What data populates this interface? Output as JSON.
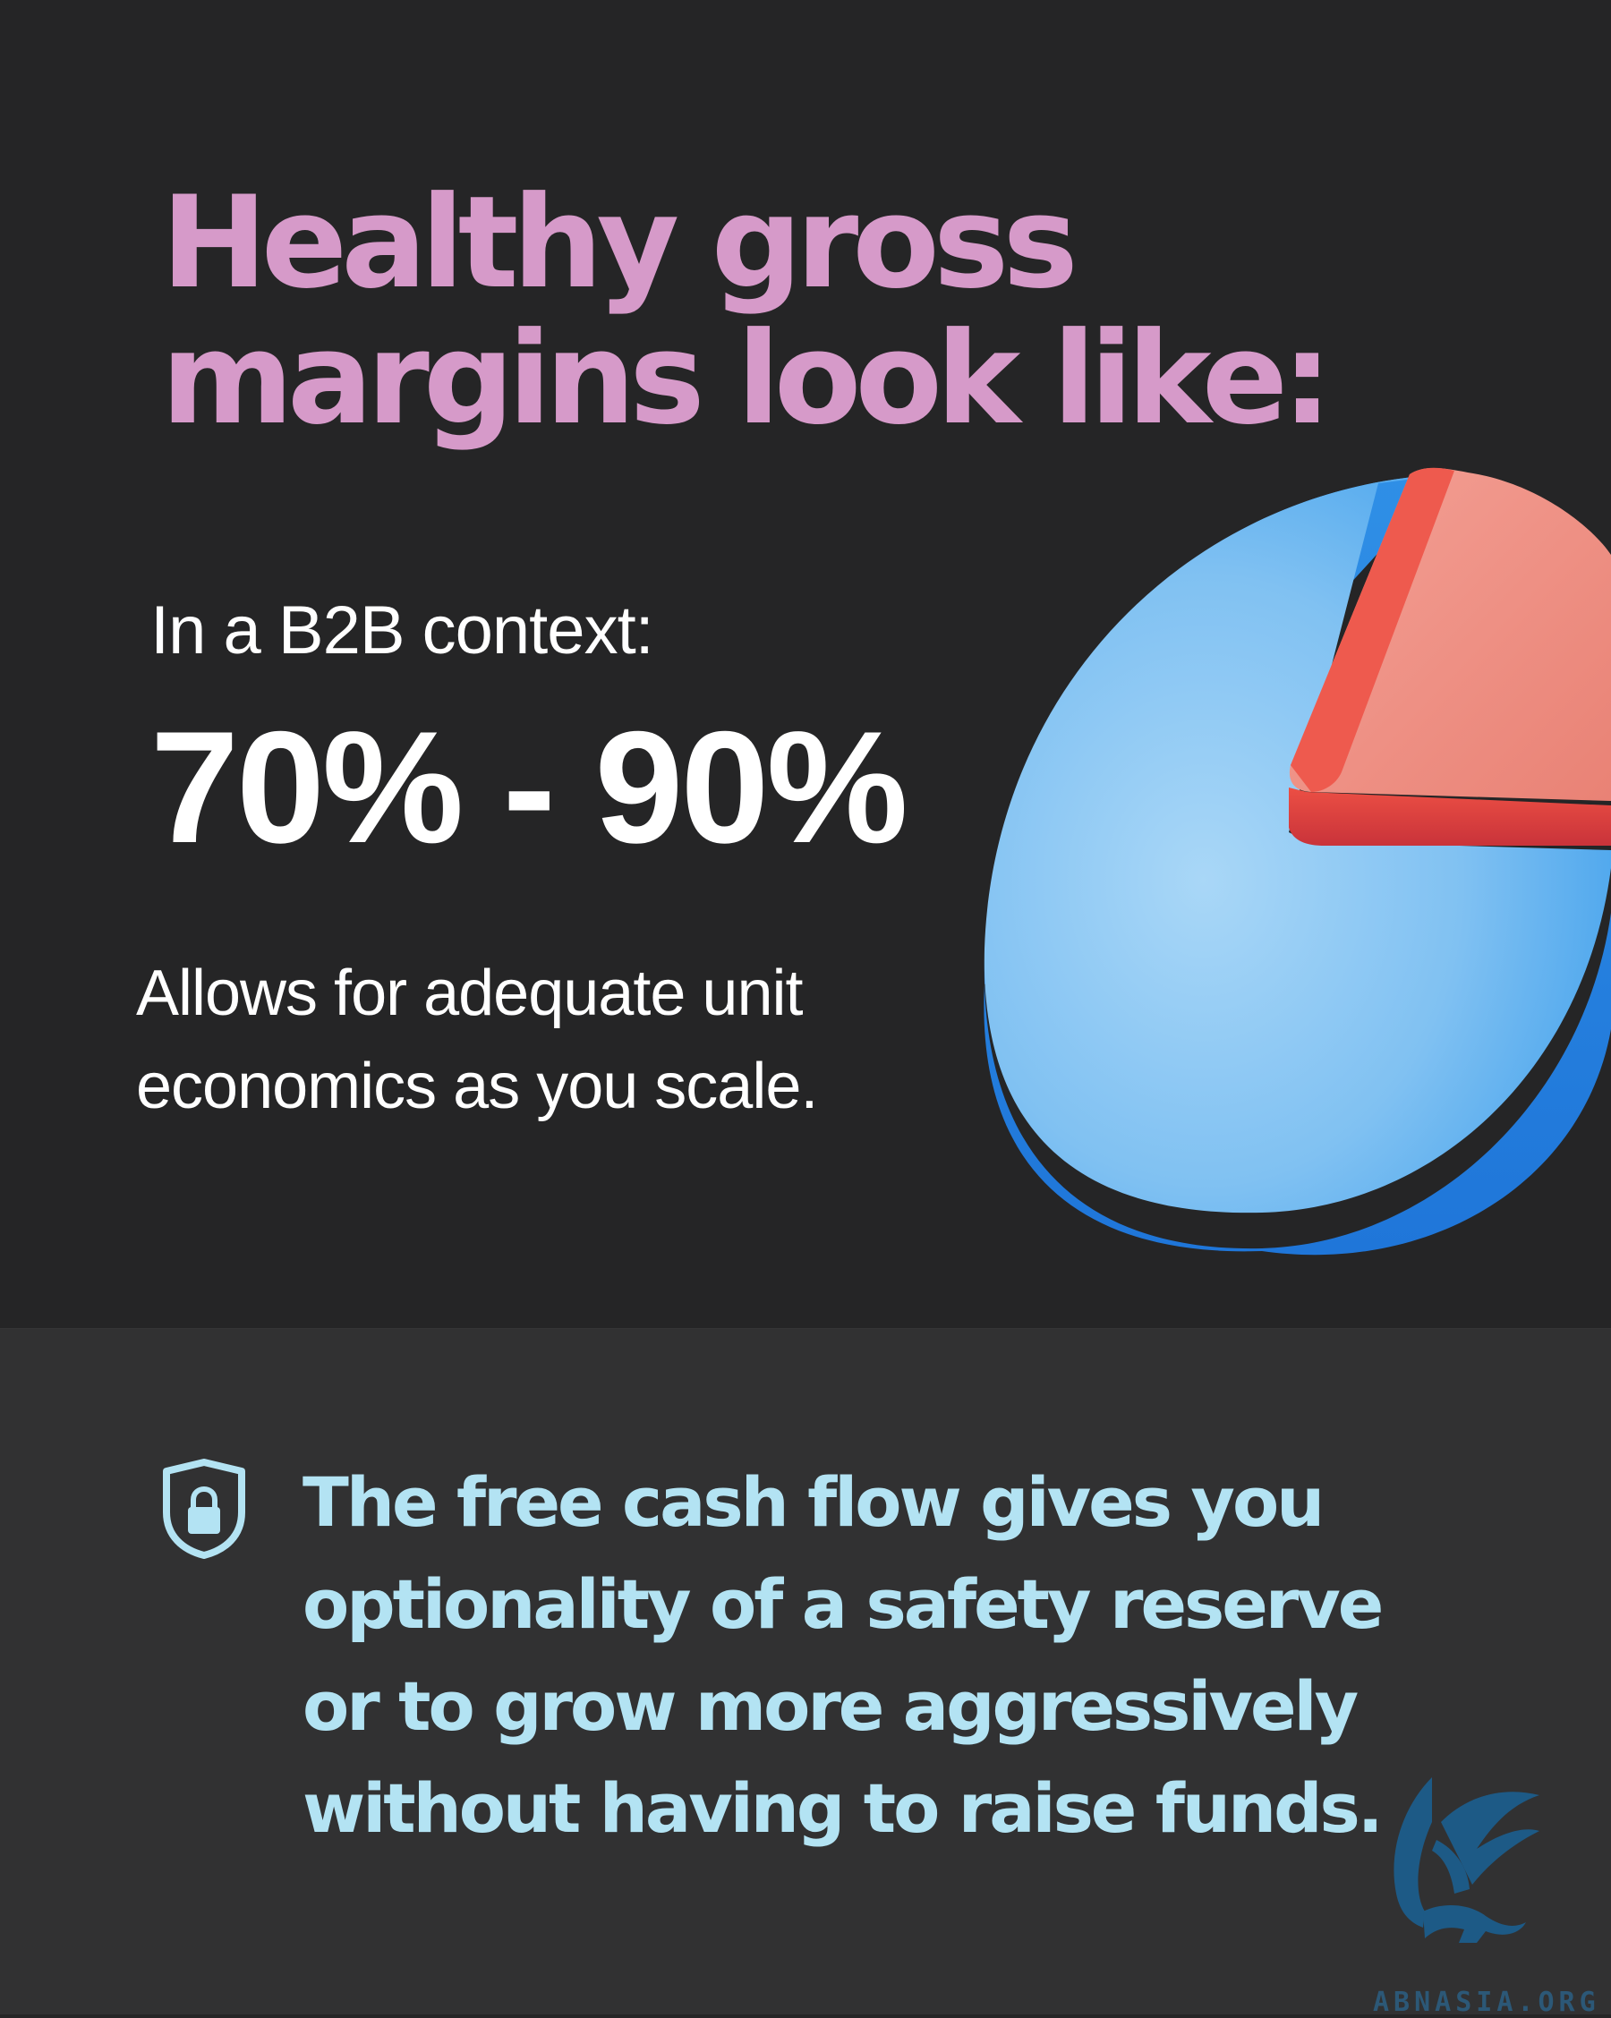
{
  "headline": {
    "line1": "Healthy gross",
    "line2": "margins look like:"
  },
  "context_label": "In a B2B context:",
  "margin_range": "70% - 90%",
  "description": {
    "line1": "Allows for adequate unit",
    "line2": "economics as you scale."
  },
  "callout": {
    "line1": "The free cash flow gives you",
    "line2": "optionality of a safety reserve",
    "line3": "or to grow more aggressively",
    "line4": "without having to raise funds."
  },
  "icons": {
    "pie": "pie-chart-icon",
    "shield": "shield-lock-icon",
    "brand": "griffin-logo-icon"
  },
  "watermark": "ABNASIA.ORG",
  "colors": {
    "background_top": "#252526",
    "background_bottom": "#313132",
    "headline": "#d69ac9",
    "body_text": "#ffffff",
    "callout_text": "#b3e3f3",
    "pie_main": "#4fb0f5",
    "pie_slice": "#ef5b4f"
  }
}
